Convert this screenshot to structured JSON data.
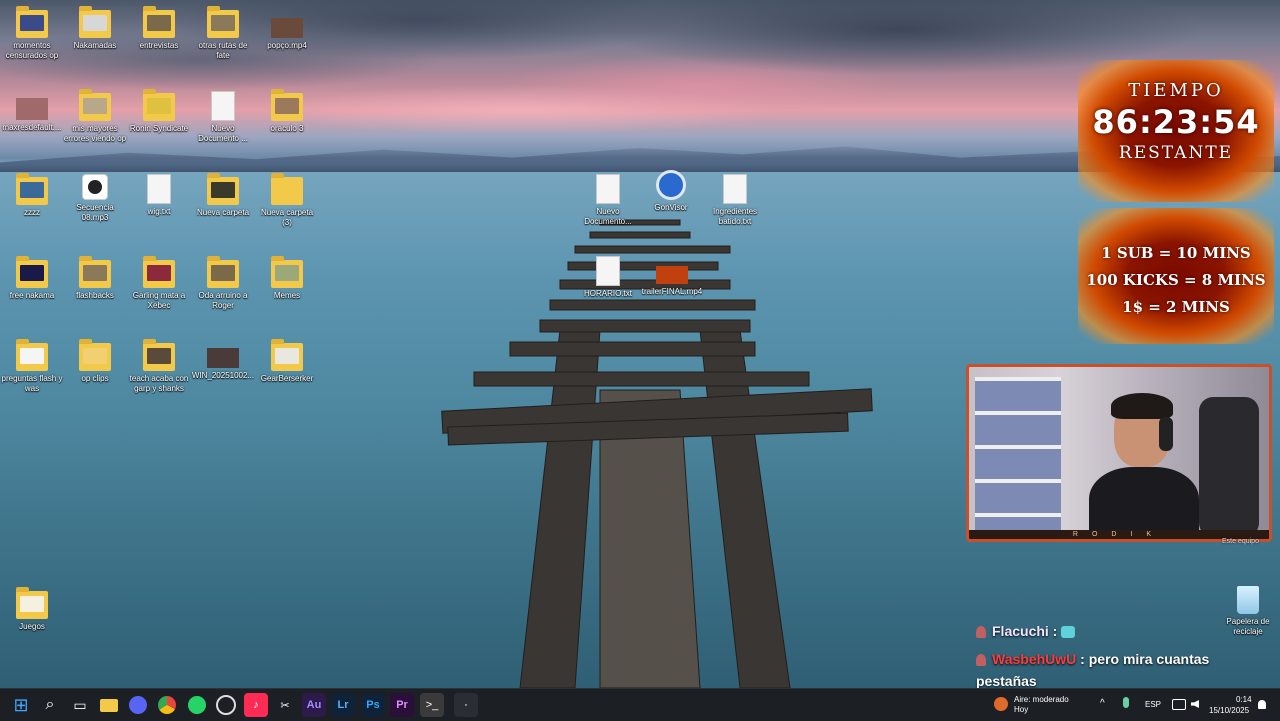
{
  "desktop": {
    "icons": [
      {
        "label": "momentos censurados op",
        "type": "folder",
        "thumb": "#3b4b8a"
      },
      {
        "label": "Nakamadas",
        "type": "folder",
        "thumb": "#d7d7d7"
      },
      {
        "label": "entrevistas",
        "type": "folder",
        "thumb": "#7a6a4a"
      },
      {
        "label": "otras rutas de fate",
        "type": "folder",
        "thumb": "#8a7a5a"
      },
      {
        "label": "popço.mp4",
        "type": "video",
        "thumb": "#6a4a3a"
      },
      {
        "label": "maxresdefault....",
        "type": "image",
        "thumb": "#a06a6a"
      },
      {
        "label": "mis mayores errores viendo op",
        "type": "folder",
        "thumb": "#b9a78a"
      },
      {
        "label": "Ronin Syndicate",
        "type": "folder",
        "thumb": "#e0c040"
      },
      {
        "label": "Nuevo Documento ...",
        "type": "doc",
        "thumb": ""
      },
      {
        "label": "oraculo 3",
        "type": "folder",
        "thumb": "#9a7a5a"
      },
      {
        "label": "zzzz",
        "type": "folder",
        "thumb": "#3a6a9a"
      },
      {
        "label": "Secuencia 08.mp3",
        "type": "media",
        "thumb": "#333"
      },
      {
        "label": "wig.txt",
        "type": "doc",
        "thumb": ""
      },
      {
        "label": "Nueva carpeta",
        "type": "folder",
        "thumb": "#3a3a2a"
      },
      {
        "label": "Nueva carpeta (3)",
        "type": "folder",
        "thumb": ""
      },
      {
        "label": "free nakama",
        "type": "folder",
        "thumb": "#1a1a4a"
      },
      {
        "label": "flashbacks",
        "type": "folder",
        "thumb": "#8a7a5a"
      },
      {
        "label": "Garling mata a Xebec",
        "type": "folder",
        "thumb": "#8a2a3a"
      },
      {
        "label": "Oda arruino a Roger",
        "type": "folder",
        "thumb": "#7a6a4a"
      },
      {
        "label": "Memes",
        "type": "folder",
        "thumb": "#9aa87a"
      },
      {
        "label": "preguntas flash y was",
        "type": "folder",
        "thumb": "#f5f5f5"
      },
      {
        "label": "op clips",
        "type": "folder",
        "thumb": "#f0d070"
      },
      {
        "label": "teach acaba con garp y shanks",
        "type": "folder",
        "thumb": "#5a4a3a"
      },
      {
        "label": "WIN_20251002...",
        "type": "image",
        "thumb": "#4a3a3a"
      },
      {
        "label": "GearBerserker",
        "type": "folder",
        "thumb": "#e8e8e0"
      },
      {
        "label": "Nuevo Documento...",
        "type": "doc",
        "thumb": ""
      },
      {
        "label": "GonVisor",
        "type": "app",
        "thumb": "#2a6ad0"
      },
      {
        "label": "Ingredientes batido.txt",
        "type": "doc",
        "thumb": ""
      },
      {
        "label": "HORARIO.txt",
        "type": "doc",
        "thumb": ""
      },
      {
        "label": "trailerFINAL.mp4",
        "type": "video",
        "thumb": "#c04010"
      },
      {
        "label": "Juegos",
        "type": "folder",
        "thumb": "#f5f0e0"
      },
      {
        "label": "Papelera de reciclaje",
        "type": "bin",
        "thumb": ""
      }
    ],
    "this_pc_label": "Este equipo"
  },
  "overlay": {
    "timer_top": "TIEMPO",
    "timer_value": "86:23:54",
    "timer_bottom": "RESTANTE",
    "rate_1": "1 SUB = 10 MINS",
    "rate_2": "100 KICKS = 8 MINS",
    "rate_3": "1$ = 2 MINS",
    "cam_brand": "RODIK"
  },
  "chat": {
    "messages": [
      {
        "user": "Flacuchi",
        "sep": " :",
        "text": ""
      },
      {
        "user": "WasbehUwU",
        "sep": " :",
        "text": " pero mira cuantas pestañas"
      }
    ]
  },
  "taskbar": {
    "apps": [
      {
        "name": "start-button",
        "label": "⊞",
        "color": "#3ea6ff"
      },
      {
        "name": "search-button",
        "label": "⌕",
        "color": "transparent"
      },
      {
        "name": "task-view-button",
        "label": "▭",
        "color": "transparent"
      },
      {
        "name": "file-explorer-button",
        "label": "",
        "color": "#f3c94a"
      },
      {
        "name": "discord-button",
        "label": "◉",
        "color": "#5865f2"
      },
      {
        "name": "chrome-button",
        "label": "●",
        "color": "#e8453c"
      },
      {
        "name": "whatsapp-button",
        "label": "✆",
        "color": "#25d366"
      },
      {
        "name": "obs-button",
        "label": "◎",
        "color": "transparent"
      },
      {
        "name": "tiktok-button",
        "label": "♪",
        "color": "#fe2c55"
      },
      {
        "name": "capcut-button",
        "label": "✂",
        "color": "#ffffff"
      },
      {
        "name": "audition-button",
        "label": "Au",
        "color": "#2b1a4a"
      },
      {
        "name": "lightroom-button",
        "label": "Lr",
        "color": "#0f2238"
      },
      {
        "name": "photoshop-button",
        "label": "Ps",
        "color": "#0f2238"
      },
      {
        "name": "premiere-button",
        "label": "Pr",
        "color": "#2a0f3a"
      },
      {
        "name": "terminal-button",
        "label": ">_",
        "color": "#3a3a3a"
      },
      {
        "name": "loading-button",
        "label": "⸱",
        "color": "transparent"
      }
    ],
    "weather_line1": "Aire: moderado",
    "weather_line2": "Hoy",
    "language": "ESP",
    "time": "0:14",
    "date": "15/10/2025"
  }
}
